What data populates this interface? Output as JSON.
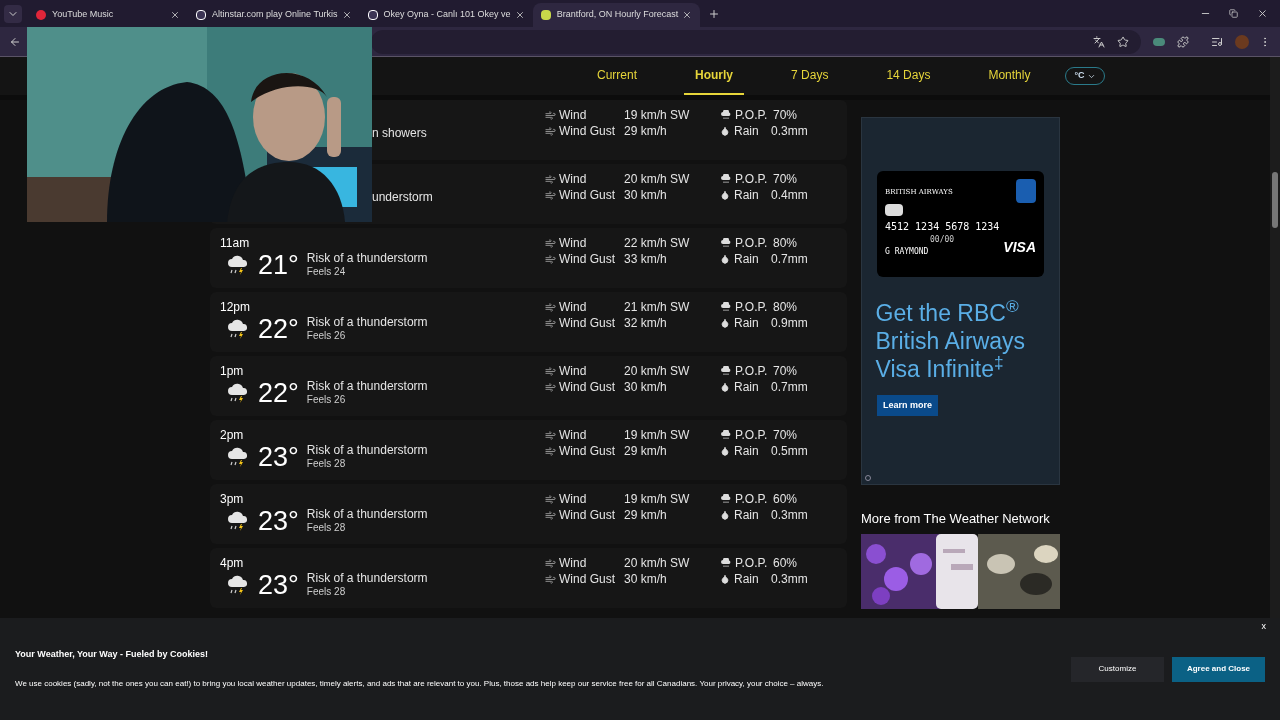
{
  "browser": {
    "tabs": [
      {
        "title": "YouTube Music",
        "selected": false
      },
      {
        "title": "Altinstar.com play Online Turkis",
        "selected": false
      },
      {
        "title": "Okey Oyna - Canlı 101 Okey ve",
        "selected": false
      },
      {
        "title": "Brantford, ON Hourly Forecast",
        "selected": true
      }
    ]
  },
  "nav": {
    "tabs": [
      {
        "label": "Current",
        "selected": false
      },
      {
        "label": "Hourly",
        "selected": true
      },
      {
        "label": "7 Days",
        "selected": false
      },
      {
        "label": "14 Days",
        "selected": false
      },
      {
        "label": "Monthly",
        "selected": false
      }
    ],
    "units": "°C"
  },
  "hours": [
    {
      "kind": "partial",
      "condition": "n showers",
      "wind_label": "Wind",
      "wind": "19 km/h SW",
      "gust_label": "Wind Gust",
      "gust": "29 km/h",
      "pop_label": "P.O.P.",
      "pop": "70%",
      "rain_label": "Rain",
      "rain": "0.3mm"
    },
    {
      "kind": "partial",
      "condition": "understorm",
      "wind_label": "Wind",
      "wind": "20 km/h SW",
      "gust_label": "Wind Gust",
      "gust": "30 km/h",
      "pop_label": "P.O.P.",
      "pop": "70%",
      "rain_label": "Rain",
      "rain": "0.4mm"
    },
    {
      "kind": "full",
      "time": "11am",
      "temp": "21°",
      "condition": "Risk of a thunderstorm",
      "feels": "Feels 24",
      "wind_label": "Wind",
      "wind": "22 km/h SW",
      "gust_label": "Wind Gust",
      "gust": "33 km/h",
      "pop_label": "P.O.P.",
      "pop": "80%",
      "rain_label": "Rain",
      "rain": "0.7mm"
    },
    {
      "kind": "full",
      "time": "12pm",
      "temp": "22°",
      "condition": "Risk of a thunderstorm",
      "feels": "Feels 26",
      "wind_label": "Wind",
      "wind": "21 km/h SW",
      "gust_label": "Wind Gust",
      "gust": "32 km/h",
      "pop_label": "P.O.P.",
      "pop": "80%",
      "rain_label": "Rain",
      "rain": "0.9mm"
    },
    {
      "kind": "full",
      "time": "1pm",
      "temp": "22°",
      "condition": "Risk of a thunderstorm",
      "feels": "Feels 26",
      "wind_label": "Wind",
      "wind": "20 km/h SW",
      "gust_label": "Wind Gust",
      "gust": "30 km/h",
      "pop_label": "P.O.P.",
      "pop": "70%",
      "rain_label": "Rain",
      "rain": "0.7mm"
    },
    {
      "kind": "full",
      "time": "2pm",
      "temp": "23°",
      "condition": "Risk of a thunderstorm",
      "feels": "Feels 28",
      "wind_label": "Wind",
      "wind": "19 km/h SW",
      "gust_label": "Wind Gust",
      "gust": "29 km/h",
      "pop_label": "P.O.P.",
      "pop": "70%",
      "rain_label": "Rain",
      "rain": "0.5mm"
    },
    {
      "kind": "full",
      "time": "3pm",
      "temp": "23°",
      "condition": "Risk of a thunderstorm",
      "feels": "Feels 28",
      "wind_label": "Wind",
      "wind": "19 km/h SW",
      "gust_label": "Wind Gust",
      "gust": "29 km/h",
      "pop_label": "P.O.P.",
      "pop": "60%",
      "rain_label": "Rain",
      "rain": "0.3mm"
    },
    {
      "kind": "full",
      "time": "4pm",
      "temp": "23°",
      "condition": "Risk of a thunderstorm",
      "feels": "Feels 28",
      "wind_label": "Wind",
      "wind": "20 km/h SW",
      "gust_label": "Wind Gust",
      "gust": "30 km/h",
      "pop_label": "P.O.P.",
      "pop": "60%",
      "rain_label": "Rain",
      "rain": "0.3mm"
    }
  ],
  "ad": {
    "card_brand": "BRITISH AIRWAYS",
    "card_number": "4512 1234 5678 1234",
    "card_expiry": "00/00",
    "card_name": "G RAYMOND",
    "card_network": "VISA",
    "headline": "Get the RBC$^{®}$ British Airways Visa Infinite$^{‡}$",
    "button": "Learn more"
  },
  "more": {
    "title": "More from The Weather Network"
  },
  "cookies": {
    "title": "Your Weather, Your Way - Fueled by Cookies!",
    "text": "We use cookies (sadly, not the ones you can eat!) to bring you local weather updates, timely alerts, and ads that are relevant to you. Plus, those ads help keep our service free for all Canadians. Your privacy, your choice – always.",
    "close": "x",
    "buttons": [
      {
        "label": "Customize",
        "kind": "secondary"
      },
      {
        "label": "Agree and Close",
        "kind": "primary"
      }
    ]
  }
}
